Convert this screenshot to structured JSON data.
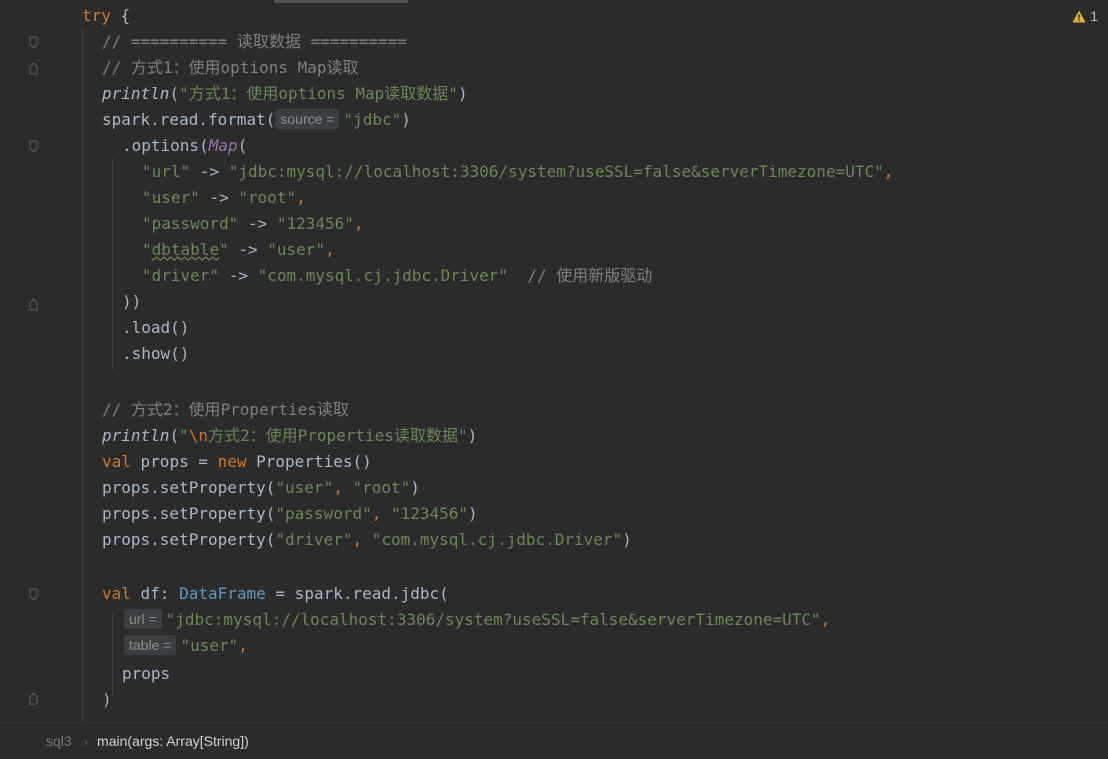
{
  "warnings": {
    "count": "1"
  },
  "breadcrumb": {
    "file": "sql3",
    "separator": "›",
    "function": "main(args: Array[String])"
  },
  "hints": {
    "source": "source =",
    "url": "url =",
    "table": "table ="
  },
  "code": {
    "try_kw": "try",
    "try_brace": " {",
    "c1": "// ========== 读取数据 ==========",
    "c2": "// 方式1：使用options Map读取",
    "println": "println",
    "p1_open": "(",
    "p1_str": "\"方式1：使用options Map读取数据\"",
    "p1_close": ")",
    "sr_prefix": "spark.read.format(",
    "jdbc_str": "\"jdbc\"",
    "close_paren": ")",
    "options_prefix": ".options(",
    "map_kw": "Map",
    "open_paren": "(",
    "url_key": "\"url\"",
    "arrow": " -> ",
    "url_val": "\"jdbc:mysql://localhost:3306/system?useSSL=false&serverTimezone=UTC\"",
    "comma": ",",
    "user_key": "\"user\"",
    "root_val": "\"root\"",
    "pwd_key": "\"password\"",
    "pwd_val": "\"123456\"",
    "dbtable_q1": "\"",
    "dbtable_word": "dbtable",
    "dbtable_q2": "\"",
    "user_val": "\"user\"",
    "driver_key": "\"driver\"",
    "driver_val": "\"com.mysql.cj.jdbc.Driver\"",
    "driver_comment": "  // 使用新版驱动",
    "close_options": "))",
    "load": ".load()",
    "show": ".show()",
    "c3": "// 方式2：使用Properties读取",
    "p2_str_q": "\"",
    "p2_esc": "\\n",
    "p2_str_rest": "方式2：使用Properties读取数据\"",
    "val_kw": "val",
    "props_decl": " props = ",
    "new_kw": "new",
    "props_ctor": " Properties()",
    "set_prefix": "props.setProperty(",
    "user_key2": "\"user\"",
    "sep": ", ",
    "root_val2": "\"root\"",
    "pwd_key2": "\"password\"",
    "pwd_val2": "\"123456\"",
    "driver_key2": "\"driver\"",
    "driver_val2": "\"com.mysql.cj.jdbc.Driver\"",
    "df_decl": " df: ",
    "df_type": "DataFrame",
    "df_rest": " = spark.read.jdbc(",
    "jdbc_url": "\"jdbc:mysql://localhost:3306/system?useSSL=false&serverTimezone=UTC\"",
    "user_table": "\"user\"",
    "props_arg": "props",
    "close_call": ")"
  }
}
